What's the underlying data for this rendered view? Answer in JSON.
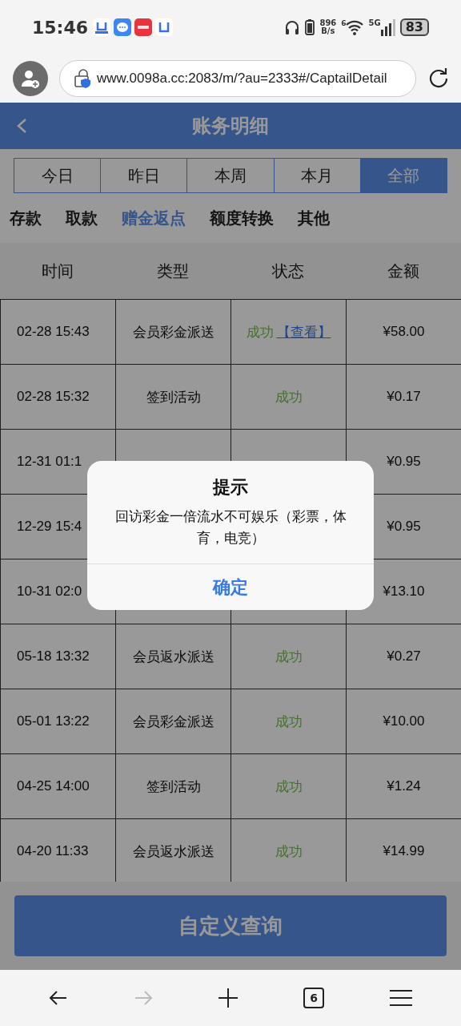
{
  "status_bar": {
    "time": "15:46",
    "network_speed": [
      "896",
      "B/s"
    ],
    "wifi_badge": "6",
    "network_type": "5G",
    "battery": "83"
  },
  "browser": {
    "url": "www.0098a.cc:2083/m/?au=2333#/CaptailDetail",
    "tab_count": "6",
    "forward_disabled": true
  },
  "page": {
    "title": "账务明细",
    "period_tabs": [
      {
        "label": "今日",
        "selected": false
      },
      {
        "label": "昨日",
        "selected": false
      },
      {
        "label": "本周",
        "selected": false
      },
      {
        "label": "本月",
        "selected": false
      },
      {
        "label": "全部",
        "selected": true
      }
    ],
    "categories": [
      {
        "label": "存款",
        "selected": false
      },
      {
        "label": "取款",
        "selected": false
      },
      {
        "label": "赠金返点",
        "selected": true
      },
      {
        "label": "额度转换",
        "selected": false
      },
      {
        "label": "其他",
        "selected": false
      }
    ],
    "columns": [
      "时间",
      "类型",
      "状态",
      "金额"
    ],
    "rows": [
      {
        "time": "02-28 15:43",
        "type": "会员彩金派送",
        "status": "成功",
        "link": "【查看】",
        "amount": "¥58.00"
      },
      {
        "time": "02-28 15:32",
        "type": "签到活动",
        "status": "成功",
        "amount": "¥0.17"
      },
      {
        "time": "12-31 01:1",
        "amount": "¥0.95"
      },
      {
        "time": "12-29 15:4",
        "amount": "¥0.95"
      },
      {
        "time": "10-31 02:0",
        "amount": "¥13.10"
      },
      {
        "time": "05-18 13:32",
        "type": "会员返水派送",
        "status": "成功",
        "amount": "¥0.27"
      },
      {
        "time": "05-01 13:22",
        "type": "会员彩金派送",
        "status": "成功",
        "amount": "¥10.00"
      },
      {
        "time": "04-25 14:00",
        "type": "签到活动",
        "status": "成功",
        "amount": "¥1.24"
      },
      {
        "time": "04-20 11:33",
        "type": "会员返水派送",
        "status": "成功",
        "amount": "¥14.99"
      }
    ],
    "query_button": "自定义查询"
  },
  "dialog": {
    "title": "提示",
    "message": "回访彩金一倍流水不可娱乐（彩票，体育，电竞）",
    "button": "确定"
  }
}
